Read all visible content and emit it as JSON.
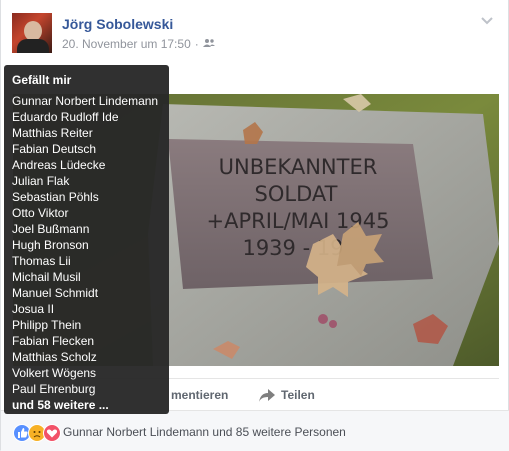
{
  "post": {
    "author": "Jörg Sobolewski",
    "timestamp": "20. November um 17:50",
    "audience_icon": "friends-icon"
  },
  "photo": {
    "plaque_lines": [
      "UNBEKANNTER",
      "SOLDAT",
      "+APRIL/MAI 1945",
      "1939  -  19"
    ]
  },
  "actions": {
    "comment_label": "mentieren",
    "share_label": "Teilen"
  },
  "reactions": {
    "summary": "Gunnar Norbert Lindemann und 85 weitere Personen",
    "icons": [
      "like-icon",
      "sad-icon",
      "love-icon"
    ],
    "colors": {
      "like": "#5890ff",
      "sad": "#f7b125",
      "love": "#f25268"
    }
  },
  "tooltip": {
    "title": "Gefällt mir",
    "names": [
      "Gunnar Norbert Lindemann",
      "Eduardo Rudloff Ide",
      "Matthias Reiter",
      "Fabian Deutsch",
      "Andreas Lüdecke",
      "Julian Flak",
      "Sebastian Pöhls",
      "Otto Viktor",
      "Joel Bußmann",
      "Hugh Bronson",
      "Thomas Lii",
      "Michail Musil",
      "Manuel Schmidt",
      "Josua II",
      "Philipp Thein",
      "Fabian Flecken",
      "Matthias Scholz",
      "Volkert Wögens",
      "Paul Ehrenburg"
    ],
    "more": "und 58 weitere ..."
  }
}
